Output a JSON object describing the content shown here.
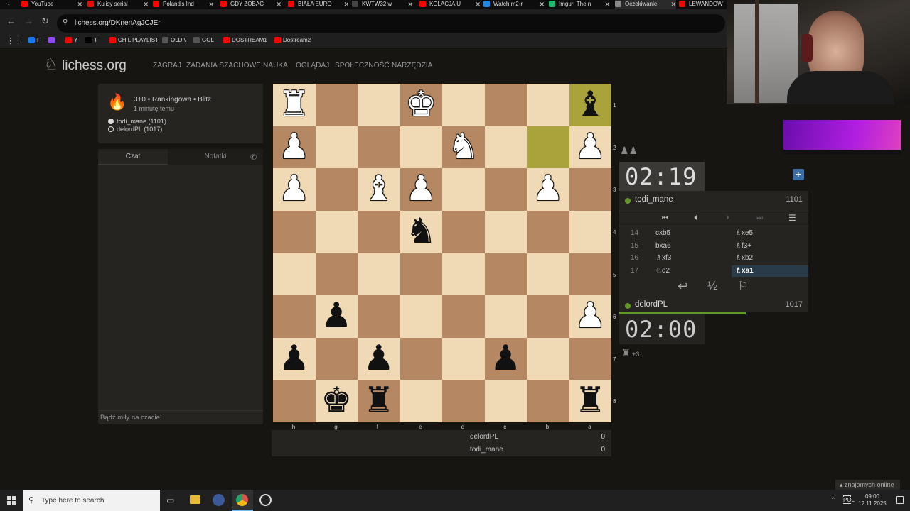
{
  "browser": {
    "tabs": [
      {
        "label": "YouTube",
        "color": "#ff0000"
      },
      {
        "label": "Kulisy serial",
        "color": "#ff0000"
      },
      {
        "label": "Poland's Ind",
        "color": "#ff0000"
      },
      {
        "label": "GDY ZOBAC",
        "color": "#ff0000"
      },
      {
        "label": "BIAŁA EURO",
        "color": "#ff0000"
      },
      {
        "label": "KWTW32 w",
        "color": "#444444"
      },
      {
        "label": "KOLACJA U",
        "color": "#ff0000"
      },
      {
        "label": "Watch m2-r",
        "color": "#1e88e5"
      },
      {
        "label": "Imgur: The n",
        "color": "#1bb76e"
      },
      {
        "label": "Oczekiwanie",
        "color": "#888888"
      },
      {
        "label": "LEWANDOW",
        "color": "#ff0000"
      }
    ],
    "url": "lichess.org/DKnenAgJCJEr",
    "bookmarks": [
      {
        "label": "F",
        "color": "#1877f2"
      },
      {
        "label": "",
        "color": "#9146ff"
      },
      {
        "label": "Y",
        "color": "#ff0000"
      },
      {
        "label": "T",
        "color": "#000000"
      },
      {
        "label": "CHIL PLAYLIST",
        "color": "#ff0000"
      },
      {
        "label": "OLDI\\",
        "color": "#555555"
      },
      {
        "label": "GOL",
        "color": "#555555"
      },
      {
        "label": "DOSTREAM1",
        "color": "#ff0000"
      },
      {
        "label": "Dostream2",
        "color": "#ff0000"
      }
    ]
  },
  "site": {
    "logo": "lichess.org",
    "nav": [
      "ZAGRAJ",
      "ZADANIA SZACHOWE",
      "NAUKA",
      "OGLĄDAJ",
      "SPOŁECZNOŚĆ",
      "NARZĘDZIA"
    ]
  },
  "game": {
    "title": "3+0 • Rankingowa • Blitz",
    "time_ago": "1 minutę temu",
    "players": [
      "todi_mane (1101)",
      "delordPL (1017)"
    ]
  },
  "chat": {
    "tab_chat": "Czat",
    "tab_notes": "Notatki",
    "placeholder": "Bądź miły na czacie!"
  },
  "board": {
    "files": [
      "h",
      "g",
      "f",
      "e",
      "d",
      "c",
      "b",
      "a"
    ],
    "ranks": [
      "1",
      "2",
      "3",
      "4",
      "5",
      "6",
      "7",
      "8"
    ],
    "light": "#f0d9b5",
    "dark": "#b58863",
    "highlight": "#aaa23a",
    "pieces": [
      {
        "sq": "h1",
        "p": "♜",
        "c": "w"
      },
      {
        "sq": "e1",
        "p": "♚",
        "c": "w"
      },
      {
        "sq": "a1",
        "p": "♝",
        "c": "b"
      },
      {
        "sq": "h2",
        "p": "♟",
        "c": "w"
      },
      {
        "sq": "d2",
        "p": "♞",
        "c": "w"
      },
      {
        "sq": "a2",
        "p": "♟",
        "c": "w"
      },
      {
        "sq": "h3",
        "p": "♟",
        "c": "w"
      },
      {
        "sq": "f3",
        "p": "♝",
        "c": "w"
      },
      {
        "sq": "e3",
        "p": "♟",
        "c": "w"
      },
      {
        "sq": "b3",
        "p": "♟",
        "c": "w"
      },
      {
        "sq": "e4",
        "p": "♞",
        "c": "b"
      },
      {
        "sq": "g6",
        "p": "♟",
        "c": "b"
      },
      {
        "sq": "a6",
        "p": "♟",
        "c": "w"
      },
      {
        "sq": "h7",
        "p": "♟",
        "c": "b"
      },
      {
        "sq": "f7",
        "p": "♟",
        "c": "b"
      },
      {
        "sq": "c7",
        "p": "♟",
        "c": "b"
      },
      {
        "sq": "g8",
        "p": "♚",
        "c": "b"
      },
      {
        "sq": "f8",
        "p": "♜",
        "c": "b"
      },
      {
        "sq": "a8",
        "p": "♜",
        "c": "b"
      }
    ],
    "highlighted": [
      "a1",
      "b2"
    ]
  },
  "scores": [
    {
      "name": "delordPL",
      "score": "0"
    },
    {
      "name": "todi_mane",
      "score": "0"
    }
  ],
  "right": {
    "top_clock": "02:19",
    "top_player": "todi_mane",
    "top_rating": "1101",
    "moves": [
      {
        "n": "14",
        "w": "cxb5",
        "b": "♗xe5"
      },
      {
        "n": "15",
        "w": "bxa6",
        "b": "♗f3+"
      },
      {
        "n": "16",
        "w": "♗xf3",
        "b": "♗xb2"
      },
      {
        "n": "17",
        "w": "♘d2",
        "b": "♗xa1"
      }
    ],
    "bottom_player": "delordPL",
    "bottom_rating": "1017",
    "bottom_clock": "02:00",
    "captured": "+3",
    "half": "½"
  },
  "footer": {
    "friends": "znajomych online"
  },
  "taskbar": {
    "search": "Type here to search",
    "lang": "POL",
    "time": "09:00",
    "date": "12.11.2025"
  }
}
